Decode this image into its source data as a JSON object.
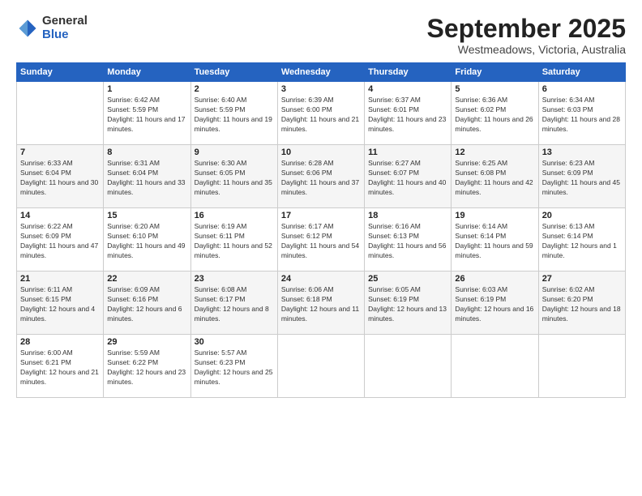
{
  "logo": {
    "general": "General",
    "blue": "Blue"
  },
  "title": "September 2025",
  "location": "Westmeadows, Victoria, Australia",
  "days_header": [
    "Sunday",
    "Monday",
    "Tuesday",
    "Wednesday",
    "Thursday",
    "Friday",
    "Saturday"
  ],
  "weeks": [
    [
      {
        "day": "",
        "sunrise": "",
        "sunset": "",
        "daylight": ""
      },
      {
        "day": "1",
        "sunrise": "Sunrise: 6:42 AM",
        "sunset": "Sunset: 5:59 PM",
        "daylight": "Daylight: 11 hours and 17 minutes."
      },
      {
        "day": "2",
        "sunrise": "Sunrise: 6:40 AM",
        "sunset": "Sunset: 5:59 PM",
        "daylight": "Daylight: 11 hours and 19 minutes."
      },
      {
        "day": "3",
        "sunrise": "Sunrise: 6:39 AM",
        "sunset": "Sunset: 6:00 PM",
        "daylight": "Daylight: 11 hours and 21 minutes."
      },
      {
        "day": "4",
        "sunrise": "Sunrise: 6:37 AM",
        "sunset": "Sunset: 6:01 PM",
        "daylight": "Daylight: 11 hours and 23 minutes."
      },
      {
        "day": "5",
        "sunrise": "Sunrise: 6:36 AM",
        "sunset": "Sunset: 6:02 PM",
        "daylight": "Daylight: 11 hours and 26 minutes."
      },
      {
        "day": "6",
        "sunrise": "Sunrise: 6:34 AM",
        "sunset": "Sunset: 6:03 PM",
        "daylight": "Daylight: 11 hours and 28 minutes."
      }
    ],
    [
      {
        "day": "7",
        "sunrise": "Sunrise: 6:33 AM",
        "sunset": "Sunset: 6:04 PM",
        "daylight": "Daylight: 11 hours and 30 minutes."
      },
      {
        "day": "8",
        "sunrise": "Sunrise: 6:31 AM",
        "sunset": "Sunset: 6:04 PM",
        "daylight": "Daylight: 11 hours and 33 minutes."
      },
      {
        "day": "9",
        "sunrise": "Sunrise: 6:30 AM",
        "sunset": "Sunset: 6:05 PM",
        "daylight": "Daylight: 11 hours and 35 minutes."
      },
      {
        "day": "10",
        "sunrise": "Sunrise: 6:28 AM",
        "sunset": "Sunset: 6:06 PM",
        "daylight": "Daylight: 11 hours and 37 minutes."
      },
      {
        "day": "11",
        "sunrise": "Sunrise: 6:27 AM",
        "sunset": "Sunset: 6:07 PM",
        "daylight": "Daylight: 11 hours and 40 minutes."
      },
      {
        "day": "12",
        "sunrise": "Sunrise: 6:25 AM",
        "sunset": "Sunset: 6:08 PM",
        "daylight": "Daylight: 11 hours and 42 minutes."
      },
      {
        "day": "13",
        "sunrise": "Sunrise: 6:23 AM",
        "sunset": "Sunset: 6:09 PM",
        "daylight": "Daylight: 11 hours and 45 minutes."
      }
    ],
    [
      {
        "day": "14",
        "sunrise": "Sunrise: 6:22 AM",
        "sunset": "Sunset: 6:09 PM",
        "daylight": "Daylight: 11 hours and 47 minutes."
      },
      {
        "day": "15",
        "sunrise": "Sunrise: 6:20 AM",
        "sunset": "Sunset: 6:10 PM",
        "daylight": "Daylight: 11 hours and 49 minutes."
      },
      {
        "day": "16",
        "sunrise": "Sunrise: 6:19 AM",
        "sunset": "Sunset: 6:11 PM",
        "daylight": "Daylight: 11 hours and 52 minutes."
      },
      {
        "day": "17",
        "sunrise": "Sunrise: 6:17 AM",
        "sunset": "Sunset: 6:12 PM",
        "daylight": "Daylight: 11 hours and 54 minutes."
      },
      {
        "day": "18",
        "sunrise": "Sunrise: 6:16 AM",
        "sunset": "Sunset: 6:13 PM",
        "daylight": "Daylight: 11 hours and 56 minutes."
      },
      {
        "day": "19",
        "sunrise": "Sunrise: 6:14 AM",
        "sunset": "Sunset: 6:14 PM",
        "daylight": "Daylight: 11 hours and 59 minutes."
      },
      {
        "day": "20",
        "sunrise": "Sunrise: 6:13 AM",
        "sunset": "Sunset: 6:14 PM",
        "daylight": "Daylight: 12 hours and 1 minute."
      }
    ],
    [
      {
        "day": "21",
        "sunrise": "Sunrise: 6:11 AM",
        "sunset": "Sunset: 6:15 PM",
        "daylight": "Daylight: 12 hours and 4 minutes."
      },
      {
        "day": "22",
        "sunrise": "Sunrise: 6:09 AM",
        "sunset": "Sunset: 6:16 PM",
        "daylight": "Daylight: 12 hours and 6 minutes."
      },
      {
        "day": "23",
        "sunrise": "Sunrise: 6:08 AM",
        "sunset": "Sunset: 6:17 PM",
        "daylight": "Daylight: 12 hours and 8 minutes."
      },
      {
        "day": "24",
        "sunrise": "Sunrise: 6:06 AM",
        "sunset": "Sunset: 6:18 PM",
        "daylight": "Daylight: 12 hours and 11 minutes."
      },
      {
        "day": "25",
        "sunrise": "Sunrise: 6:05 AM",
        "sunset": "Sunset: 6:19 PM",
        "daylight": "Daylight: 12 hours and 13 minutes."
      },
      {
        "day": "26",
        "sunrise": "Sunrise: 6:03 AM",
        "sunset": "Sunset: 6:19 PM",
        "daylight": "Daylight: 12 hours and 16 minutes."
      },
      {
        "day": "27",
        "sunrise": "Sunrise: 6:02 AM",
        "sunset": "Sunset: 6:20 PM",
        "daylight": "Daylight: 12 hours and 18 minutes."
      }
    ],
    [
      {
        "day": "28",
        "sunrise": "Sunrise: 6:00 AM",
        "sunset": "Sunset: 6:21 PM",
        "daylight": "Daylight: 12 hours and 21 minutes."
      },
      {
        "day": "29",
        "sunrise": "Sunrise: 5:59 AM",
        "sunset": "Sunset: 6:22 PM",
        "daylight": "Daylight: 12 hours and 23 minutes."
      },
      {
        "day": "30",
        "sunrise": "Sunrise: 5:57 AM",
        "sunset": "Sunset: 6:23 PM",
        "daylight": "Daylight: 12 hours and 25 minutes."
      },
      {
        "day": "",
        "sunrise": "",
        "sunset": "",
        "daylight": ""
      },
      {
        "day": "",
        "sunrise": "",
        "sunset": "",
        "daylight": ""
      },
      {
        "day": "",
        "sunrise": "",
        "sunset": "",
        "daylight": ""
      },
      {
        "day": "",
        "sunrise": "",
        "sunset": "",
        "daylight": ""
      }
    ]
  ]
}
